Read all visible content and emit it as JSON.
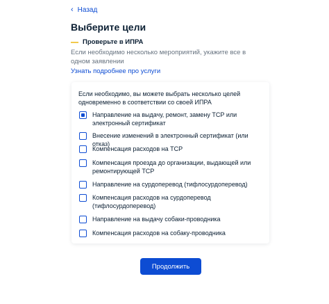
{
  "nav": {
    "back_label": "Назад"
  },
  "page_title": "Выберите цели",
  "hint": {
    "title": "Проверьте в ИПРА",
    "text": "Если необходимо несколько мероприятий, укажите все в одном заявлении",
    "link": "Узнать подробнее про услуги"
  },
  "goals": {
    "intro": "Если необходимо, вы можете выбрать несколько целей одновременно в соответствии со своей ИПРА",
    "options": [
      {
        "label": "Направление на выдачу, ремонт, замену ТСР или электронный сертификат",
        "checked": true
      },
      {
        "label": "Внесение изменений в электронный сертификат (или отказ)",
        "checked": false
      },
      {
        "label": "Компенсация расходов на ТСР",
        "checked": false
      },
      {
        "label": "Компенсация проезда до организации, выдающей или ремонтирующей ТСР",
        "checked": false
      },
      {
        "label": "Направление на сурдоперевод (тифлосурдоперевод)",
        "checked": false
      },
      {
        "label": "Компенсация расходов на сурдоперевод (тифлосурдоперевод)",
        "checked": false
      },
      {
        "label": "Направление на выдачу собаки-проводника",
        "checked": false
      },
      {
        "label": "Компенсация расходов на собаку-проводника",
        "checked": false
      }
    ]
  },
  "submit_label": "Продолжить",
  "colors": {
    "accent": "#0d4cd3",
    "hint_bar": "#f2c94c",
    "text": "#0b1f33",
    "muted": "#66727f"
  }
}
